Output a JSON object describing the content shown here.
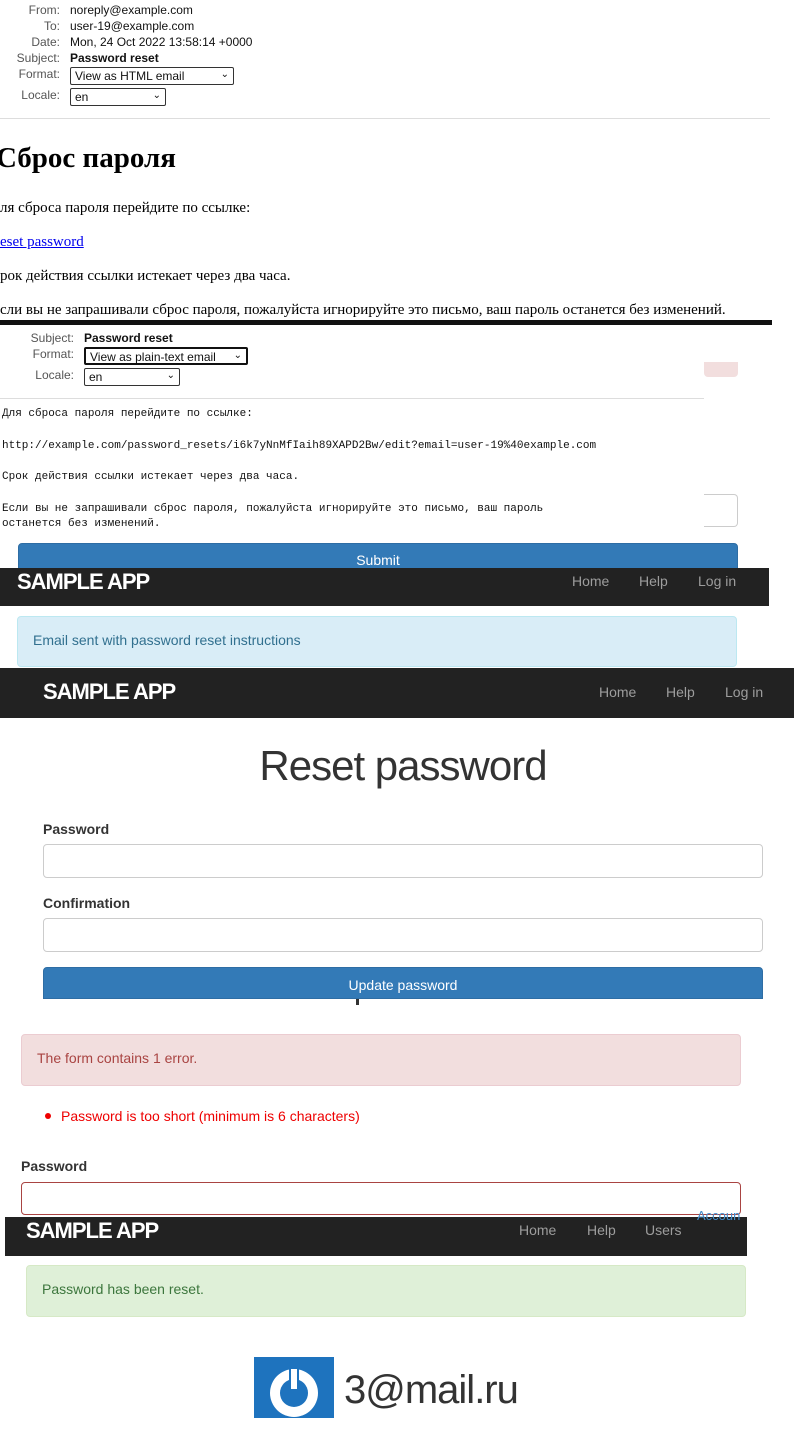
{
  "email_html": {
    "from_label": "From:",
    "from_value": "noreply@example.com",
    "to_label": "To:",
    "to_value": "user-19@example.com",
    "date_label": "Date:",
    "date_value": "Mon, 24 Oct 2022 13:58:14 +0000",
    "subject_label": "Subject:",
    "subject_value": "Password reset",
    "format_label": "Format:",
    "format_value": "View as HTML email",
    "locale_label": "Locale:",
    "locale_value": "en",
    "heading": "Сброс пароля",
    "para1": "ля сброса пароля перейдите по ссылке:",
    "link": "eset password",
    "para2": "рок действия ссылки истекает через два часа.",
    "para3": "сли вы не запрашивали сброс пароля, пожалуйста игнорируйте это письмо, ваш пароль останется без изменений."
  },
  "email_text": {
    "subject_label": "Subject:",
    "subject_value": "Password reset",
    "format_label": "Format:",
    "format_value": "View as plain-text email",
    "locale_label": "Locale:",
    "locale_value": "en",
    "line1": "Для сброса пароля перейдите по ссылке:",
    "line2": "http://example.com/password_resets/i6k7yNnMfIaih89XAPD2Bw/edit?email=user-19%40example.com",
    "line3": "Срок действия ссылки истекает через два часа.",
    "line4": "Если вы не запрашивали сброс пароля, пожалуйста игнорируйте это письмо, ваш пароль",
    "line5": "останется без изменений.",
    "submit_label": "Submit"
  },
  "navbar1": {
    "brand": "SAMPLE APP",
    "home": "Home",
    "help": "Help",
    "login": "Log in"
  },
  "info_alert": "Email sent with password reset instructions",
  "navbar2": {
    "brand": "SAMPLE APP",
    "home": "Home",
    "help": "Help",
    "login": "Log in"
  },
  "reset_form": {
    "title": "Reset password",
    "password_label": "Password",
    "confirmation_label": "Confirmation",
    "update_button": "Update password"
  },
  "error_panel": {
    "alert": "The form contains 1 error.",
    "error_item": "Password is too short (minimum is 6 characters)",
    "password_label": "Password",
    "partial_link": "Accoun"
  },
  "navbar3": {
    "brand": "SAMPLE APP",
    "home": "Home",
    "help": "Help",
    "users": "Users"
  },
  "success_alert": "Password has been reset.",
  "profile": {
    "name": "3@mail.ru"
  },
  "colors": {
    "navbar_bg": "#222222",
    "primary": "#337ab7",
    "info_bg": "#d9edf7",
    "danger_bg": "#f2dede",
    "success_bg": "#dff0d8",
    "gravatar": "#1e73be"
  }
}
